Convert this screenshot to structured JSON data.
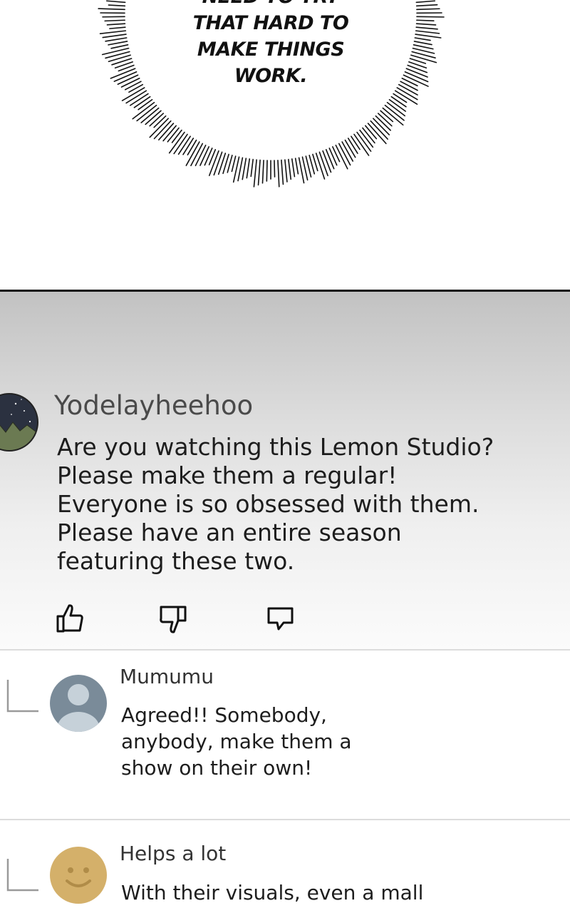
{
  "panel": {
    "speech_lines": [
      "NEED TO TRY",
      "THAT HARD TO",
      "MAKE THINGS",
      "WORK."
    ]
  },
  "main_comment": {
    "username": "Yodelayheehoo",
    "lines": [
      "Are you watching this Lemon Studio?",
      "Please make them a regular!",
      "Everyone is so obsessed with them.",
      "Please have an entire season",
      "featuring these two."
    ],
    "actions": {
      "like_icon": "thumbs-up-icon",
      "dislike_icon": "thumbs-down-icon",
      "reply_icon": "speech-bubble-icon"
    }
  },
  "replies": [
    {
      "username": "Mumumu",
      "avatar": "default-user-icon",
      "lines": [
        "Agreed!! Somebody,",
        "anybody, make them a",
        "show on their own!"
      ]
    },
    {
      "username": "Helps a lot",
      "avatar": "smiley-face-icon",
      "lines": [
        "With their visuals, even a mall"
      ]
    }
  ],
  "colors": {
    "panel_border": "#111111",
    "username": "#4a4a4a",
    "default_avatar": "#7a8b99",
    "smiley_avatar": "#d4b06a"
  }
}
